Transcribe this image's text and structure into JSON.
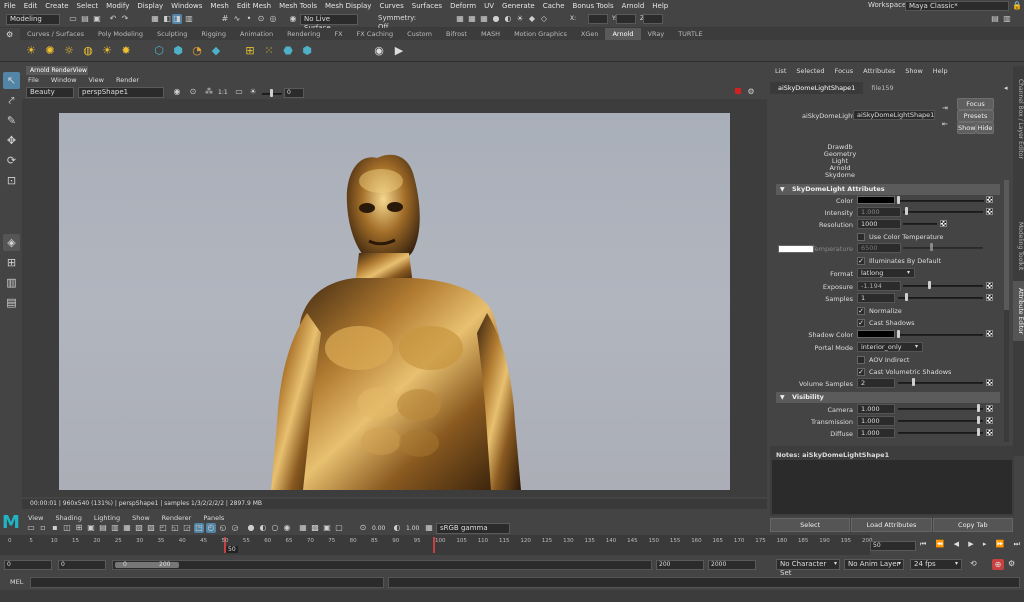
{
  "menubar": {
    "items": [
      "File",
      "Edit",
      "Create",
      "Select",
      "Modify",
      "Display",
      "Windows",
      "Mesh",
      "Edit Mesh",
      "Mesh Tools",
      "Mesh Display",
      "Curves",
      "Surfaces",
      "Deform",
      "UV",
      "Generate",
      "Cache",
      "Bonus Tools",
      "Arnold",
      "Help"
    ],
    "workspace_label": "Workspace :",
    "workspace_value": "Maya Classic*"
  },
  "status": {
    "mode": "Modeling",
    "live_surface": "No Live Surface",
    "symmetry": "Symmetry: Off",
    "x_label": "X:",
    "y_label": "Y:",
    "z_label": "Z:"
  },
  "shelf": {
    "tabs": [
      "Curves / Surfaces",
      "Poly Modeling",
      "Sculpting",
      "Rigging",
      "Animation",
      "Rendering",
      "FX",
      "FX Caching",
      "Custom",
      "Bifrost",
      "MASH",
      "Motion Graphics",
      "XGen",
      "Arnold",
      "VRay",
      "TURTLE"
    ],
    "active_tab": "Arnold"
  },
  "renderview": {
    "tab": "Arnold RenderView",
    "menu": [
      "File",
      "Window",
      "View",
      "Render"
    ],
    "aov": "Beauty",
    "camera": "perspShape1",
    "ratio": "1:1",
    "exposure": "0",
    "status": "00:00:01 | 960x540 (131%) | perspShape1 | samples 1/3/2/2/2/2 | 2897.9 MB"
  },
  "viewport": {
    "menu": [
      "View",
      "Shading",
      "Lighting",
      "Show",
      "Renderer",
      "Panels"
    ],
    "val1": "0.00",
    "val2": "1.00",
    "colorspace": "sRGB gamma"
  },
  "attr_editor": {
    "menu": [
      "List",
      "Selected",
      "Focus",
      "Attributes",
      "Show",
      "Help"
    ],
    "tabs": [
      "aiSkyDomeLightShape1",
      "file159"
    ],
    "node_label": "aiSkyDomeLight:",
    "node_name": "aiSkyDomeLightShape1",
    "focus_btn": "Focus",
    "presets_btn": "Presets",
    "show_btn": "Show",
    "hide_btn": "Hide",
    "node_types": [
      "Drawdb",
      "Geometry",
      "Light",
      "Arnold",
      "Skydome"
    ],
    "section1": "SkyDomeLight Attributes",
    "color_label": "Color",
    "intensity_label": "Intensity",
    "intensity_val": "1.000",
    "resolution_label": "Resolution",
    "resolution_val": "1000",
    "use_color_temp": "Use Color Temperature",
    "temperature_label": "Temperature",
    "temperature_val": "6500",
    "illum_default": "Illuminates By Default",
    "format_label": "Format",
    "format_val": "latlong",
    "exposure_label": "Exposure",
    "exposure_val": "-1.194",
    "samples_label": "Samples",
    "samples_val": "1",
    "normalize": "Normalize",
    "cast_shadows": "Cast Shadows",
    "shadow_color_label": "Shadow Color",
    "portal_mode_label": "Portal Mode",
    "portal_mode_val": "interior_only",
    "aov_indirect": "AOV Indirect",
    "cast_vol_shadows": "Cast Volumetric Shadows",
    "volume_samples_label": "Volume Samples",
    "volume_samples_val": "2",
    "section2": "Visibility",
    "camera_label": "Camera",
    "camera_val": "1.000",
    "transmission_label": "Transmission",
    "transmission_val": "1.000",
    "diffuse_label": "Diffuse",
    "diffuse_val": "1.000",
    "notes": "Notes:  aiSkyDomeLightShape1",
    "select_btn": "Select",
    "load_attr_btn": "Load Attributes",
    "copy_tab_btn": "Copy Tab",
    "colors": {
      "color_swatch": "#000000",
      "temp_swatch": "#ffffff",
      "shadow_swatch": "#000000"
    }
  },
  "sidetabs": [
    "Channel Box / Layer Editor",
    "Modeling Toolkit",
    "Attribute Editor"
  ],
  "timeline": {
    "ticks": [
      "0",
      "5",
      "10",
      "15",
      "20",
      "25",
      "30",
      "35",
      "40",
      "45",
      "50",
      "55",
      "60",
      "65",
      "70",
      "75",
      "80",
      "85",
      "90",
      "95",
      "100",
      "105",
      "110",
      "115",
      "120",
      "125",
      "130",
      "135",
      "140",
      "145",
      "150",
      "155",
      "160",
      "165",
      "170",
      "175",
      "180",
      "185",
      "190",
      "195",
      "200"
    ],
    "current_frame": "50",
    "current_display": "50",
    "range_start": "0",
    "range_start2": "0",
    "range_inner_start": "0",
    "range_inner_end": "200",
    "range_end": "200",
    "range_end2": "2000",
    "character_set": "No Character Set",
    "anim_layer": "No Anim Layer",
    "fps": "24 fps"
  },
  "cmdline": {
    "label": "MEL"
  }
}
